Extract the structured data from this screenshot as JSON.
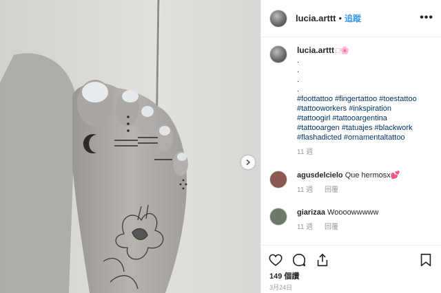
{
  "post": {
    "username": "lucia.arttt",
    "separator": "•",
    "follow_label": "追蹤",
    "more_label": "•••"
  },
  "caption": {
    "username": "lucia.arttt",
    "emoji": "□🌸",
    "dots": [
      ".",
      ".",
      ".",
      "."
    ],
    "hashtags": [
      "#foottattoo #fingertattoo #toestattoo",
      "#tattooworkers #inkspiration",
      "#tattoogirl #tattooargentina",
      "#tattooargen #tatuajes #blackwork",
      "#flashadicted #ornamentaltattoo"
    ],
    "time": "11 週"
  },
  "comments": [
    {
      "username": "agusdelcielo",
      "text": "Que hermosx💕",
      "time": "11 週",
      "reply_label": "回覆",
      "avatar_color": "#8a5a52"
    },
    {
      "username": "giarizaa",
      "text": "Woooowwwww",
      "time": "11 週",
      "reply_label": "回覆",
      "avatar_color": "#6d7a6a"
    }
  ],
  "footer": {
    "likes": "149 個讚",
    "date": "3月24日"
  },
  "icons": {
    "like": "heart-icon",
    "comment": "comment-icon",
    "share": "share-icon",
    "save": "bookmark-icon",
    "next": "chevron-right-icon"
  },
  "colors": {
    "link": "#3897f0",
    "hashtag": "#003569",
    "muted": "#999999"
  }
}
